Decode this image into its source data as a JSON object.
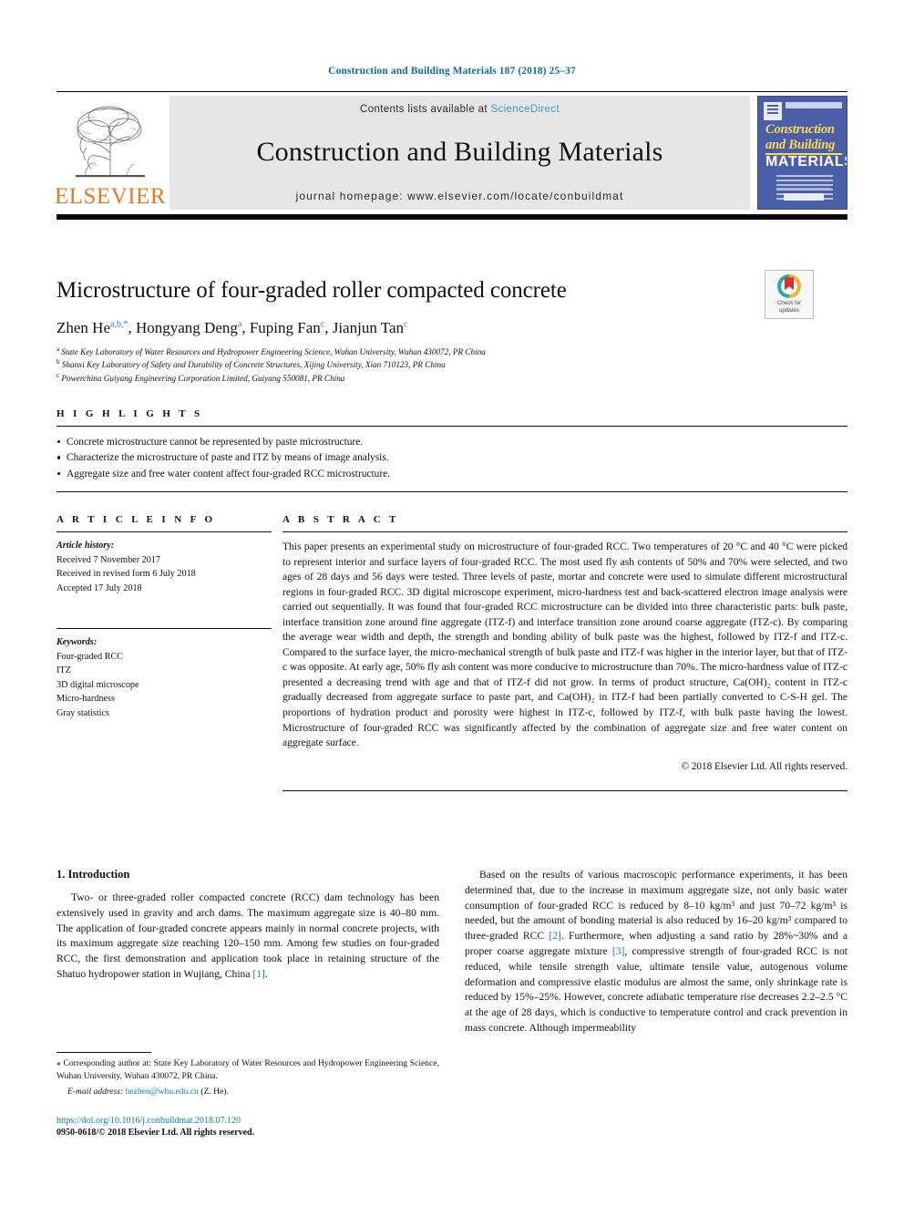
{
  "running_head": "Construction and Building Materials 187 (2018) 25–37",
  "masthead": {
    "contents_prefix": "Contents lists available at ",
    "sciencedirect": "ScienceDirect",
    "journal_title": "Construction and Building Materials",
    "homepage": "journal homepage: www.elsevier.com/locate/conbuildmat",
    "publisher_word": "ELSEVIER",
    "cover": {
      "line1": "Construction",
      "line2": "and Building",
      "line3": "MATERIALS"
    },
    "colors": {
      "link_blue": "#3e9ad4",
      "elsevier_orange": "#E87722",
      "cover_blue": "#4b5fa8",
      "cover_yellow": "#ffd84d"
    }
  },
  "crossmark": {
    "line1": "Check for",
    "line2": "updates"
  },
  "article": {
    "title": "Microstructure of four-graded roller compacted concrete",
    "authors": [
      {
        "name": "Zhen He",
        "marks": "a,b,*"
      },
      {
        "name": "Hongyang Deng",
        "marks": "a"
      },
      {
        "name": "Fuping Fan",
        "marks": "c"
      },
      {
        "name": "Jianjun Tan",
        "marks": "c"
      }
    ],
    "affiliations": [
      {
        "mark": "a",
        "text": "State Key Laboratory of Water Resources and Hydropower Engineering Science, Wuhan University, Wuhan 430072, PR China"
      },
      {
        "mark": "b",
        "text": "Shanxi Key Laboratory of Safety and Durability of Concrete Structures, Xijing University, Xian 710123, PR China"
      },
      {
        "mark": "c",
        "text": "Powerchina Guiyang Engineering Corporation Limited, Guiyang 550081, PR China"
      }
    ]
  },
  "highlights": {
    "label": "H I G H L I G H T S",
    "items": [
      "Concrete microstructure cannot be represented by paste microstructure.",
      "Characterize the microstructure of paste and ITZ by means of image analysis.",
      "Aggregate size and free water content affect four-graded RCC microstructure."
    ]
  },
  "article_info": {
    "label": "A R T I C L E   I N F O",
    "history_label": "Article history:",
    "history": [
      "Received 7 November 2017",
      "Received in revised form 6 July 2018",
      "Accepted 17 July 2018"
    ],
    "keywords_label": "Keywords:",
    "keywords": [
      "Four-graded RCC",
      "ITZ",
      "3D digital microscope",
      "Micro-hardness",
      "Gray statistics"
    ]
  },
  "abstract": {
    "label": "A B S T R A C T",
    "text": "This paper presents an experimental study on microstructure of four-graded RCC. Two temperatures of 20 °C and 40 °C were picked to represent interior and surface layers of four-graded RCC. The most used fly ash contents of 50% and 70% were selected, and two ages of 28 days and 56 days were tested. Three levels of paste, mortar and concrete were used to simulate different microstructural regions in four-graded RCC. 3D digital microscope experiment, micro-hardness test and back-scattered electron image analysis were carried out sequentially. It was found that four-graded RCC microstructure can be divided into three characteristic parts: bulk paste, interface transition zone around fine aggregate (ITZ-f) and interface transition zone around coarse aggregate (ITZ-c). By comparing the average wear width and depth, the strength and bonding ability of bulk paste was the highest, followed by ITZ-f and ITZ-c. Compared to the surface layer, the micro-mechanical strength of bulk paste and ITZ-f was higher in the interior layer, but that of ITZ-c was opposite. At early age, 50% fly ash content was more conducive to microstructure than 70%. The micro-hardness value of ITZ-c presented a decreasing trend with age and that of ITZ-f did not grow. In terms of product structure, Ca(OH)₂ content in ITZ-c gradually decreased from aggregate surface to paste part, and Ca(OH)₂ in ITZ-f had been partially converted to C-S-H gel. The proportions of hydration product and porosity were highest in ITZ-c, followed by ITZ-f, with bulk paste having the lowest. Microstructure of four-graded RCC was significantly affected by the combination of aggregate size and free water content on aggregate surface.",
    "copyright": "© 2018 Elsevier Ltd. All rights reserved."
  },
  "body": {
    "section_heading": "1. Introduction",
    "left_paragraph": "Two- or three-graded roller compacted concrete (RCC) dam technology has been extensively used in gravity and arch dams. The maximum aggregate size is 40–80 mm. The application of four-graded concrete appears mainly in normal concrete projects, with its maximum aggregate size reaching 120–150 mm. Among few studies on four-graded RCC, the first demonstration and application took place in retaining structure of the Shatuo hydropower station in Wujiang, China ",
    "left_ref": "[1]",
    "left_tail": ".",
    "right_p1": "Based on the results of various macroscopic performance experiments, it has been determined that, due to the increase in maximum aggregate size, not only basic water consumption of four-graded RCC is reduced by 8–10 kg/m³ and just 70–72 kg/m³ is needed, but the amount of bonding material is also reduced by 16–20 kg/m³ compared to three-graded RCC ",
    "right_ref1": "[2]",
    "right_p2": ". Furthermore, when adjusting a sand ratio by 28%~30% and a proper coarse aggregate mixture ",
    "right_ref2": "[3]",
    "right_p3": ", compressive strength of four-graded RCC is not reduced, while tensile strength value, ultimate tensile value, autogenous volume deformation and compressive elastic modulus are almost the same, only shrinkage rate is reduced by 15%–25%. However, concrete adiabatic temperature rise decreases 2.2–2.5 °C at the age of 28 days, which is conductive to temperature control and crack prevention in mass concrete. Although impermeability"
  },
  "footnote": {
    "corresponding": "⁎ Corresponding author at: State Key Laboratory of Water Resources and Hydropower Engineering Science, Wuhan University, Wuhan 430072, PR China.",
    "email_label": "E-mail address:",
    "email": "hezhen@whu.edu.cn",
    "email_suffix": "(Z. He)."
  },
  "doi": {
    "url": "https://doi.org/10.1016/j.conbuildmat.2018.07.120",
    "issn": "0950-0618/© 2018 Elsevier Ltd. All rights reserved."
  }
}
